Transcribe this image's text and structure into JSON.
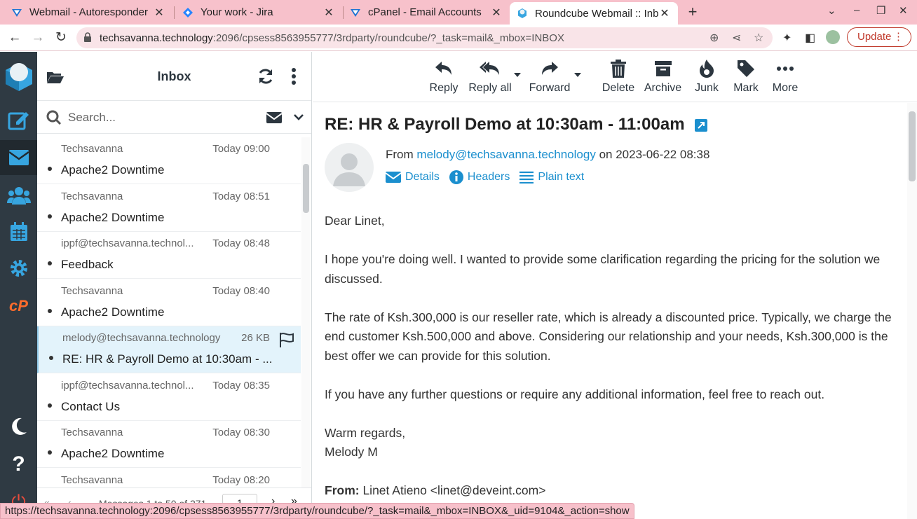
{
  "browser": {
    "tabs": [
      {
        "title": "Webmail - Autoresponder",
        "icon": "cpanel-icon"
      },
      {
        "title": "Your work - Jira",
        "icon": "jira-icon"
      },
      {
        "title": "cPanel - Email Accounts",
        "icon": "cpanel-icon"
      },
      {
        "title": "Roundcube Webmail :: Inb",
        "icon": "roundcube-icon",
        "active": true
      }
    ],
    "url_host": "techsavanna.technology",
    "url_path": ":2096/cpsess8563955777/3rdparty/roundcube/?_task=mail&_mbox=INBOX",
    "update_label": "Update",
    "status_url": "https://techsavanna.technology:2096/cpsess8563955777/3rdparty/roundcube/?_task=mail&_mbox=INBOX&_uid=9104&_action=show"
  },
  "mailbox": {
    "title": "Inbox",
    "search_placeholder": "Search...",
    "footer_count": "Messages 1 to 50 of 271",
    "page": "1"
  },
  "messages": [
    {
      "from": "Techsavanna",
      "date": "Today 09:00",
      "subject": "Apache2 Downtime"
    },
    {
      "from": "Techsavanna",
      "date": "Today 08:51",
      "subject": "Apache2 Downtime"
    },
    {
      "from": "ippf@techsavanna.technol...",
      "date": "Today 08:48",
      "subject": "Feedback"
    },
    {
      "from": "Techsavanna",
      "date": "Today 08:40",
      "subject": "Apache2 Downtime"
    },
    {
      "from": "melody@techsavanna.technology",
      "date": "26 KB",
      "subject": "RE: HR & Payroll Demo at 10:30am - ...",
      "selected": true
    },
    {
      "from": "ippf@techsavanna.technol...",
      "date": "Today 08:35",
      "subject": "Contact Us"
    },
    {
      "from": "Techsavanna",
      "date": "Today 08:30",
      "subject": "Apache2 Downtime"
    },
    {
      "from": "Techsavanna",
      "date": "Today 08:20",
      "subject": ""
    }
  ],
  "toolbar": {
    "reply": "Reply",
    "reply_all": "Reply all",
    "forward": "Forward",
    "delete": "Delete",
    "archive": "Archive",
    "junk": "Junk",
    "mark": "Mark",
    "more": "More"
  },
  "email": {
    "subject": "RE: HR & Payroll Demo at 10:30am - 11:00am",
    "from_label": "From",
    "from_address": "melody@techsavanna.technology",
    "on_label": "on",
    "date": "2023-06-22 08:38",
    "links": {
      "details": "Details",
      "headers": "Headers",
      "plain_text": "Plain text"
    },
    "greeting": "Dear Linet,",
    "para1": "I hope you're doing well. I wanted to provide some clarification regarding the pricing for the solution we discussed.",
    "para2": "The rate of Ksh.300,000 is our reseller rate, which is already a discounted price. Typically, we charge the end customer Ksh.500,000 and above. Considering our relationship and your needs, Ksh.300,000 is the best offer we can provide for this solution.",
    "para3": "If you have any further questions or require any additional information, feel free to reach out.",
    "signoff": "Warm regards,",
    "signature": "Melody M",
    "quoted_from_label": "From:",
    "quoted_from": "Linet Atieno <linet@deveint.com>"
  },
  "colors": {
    "accent": "#1b8fce",
    "rail": "#2f3a43",
    "tabbar": "#f7c1cb"
  }
}
